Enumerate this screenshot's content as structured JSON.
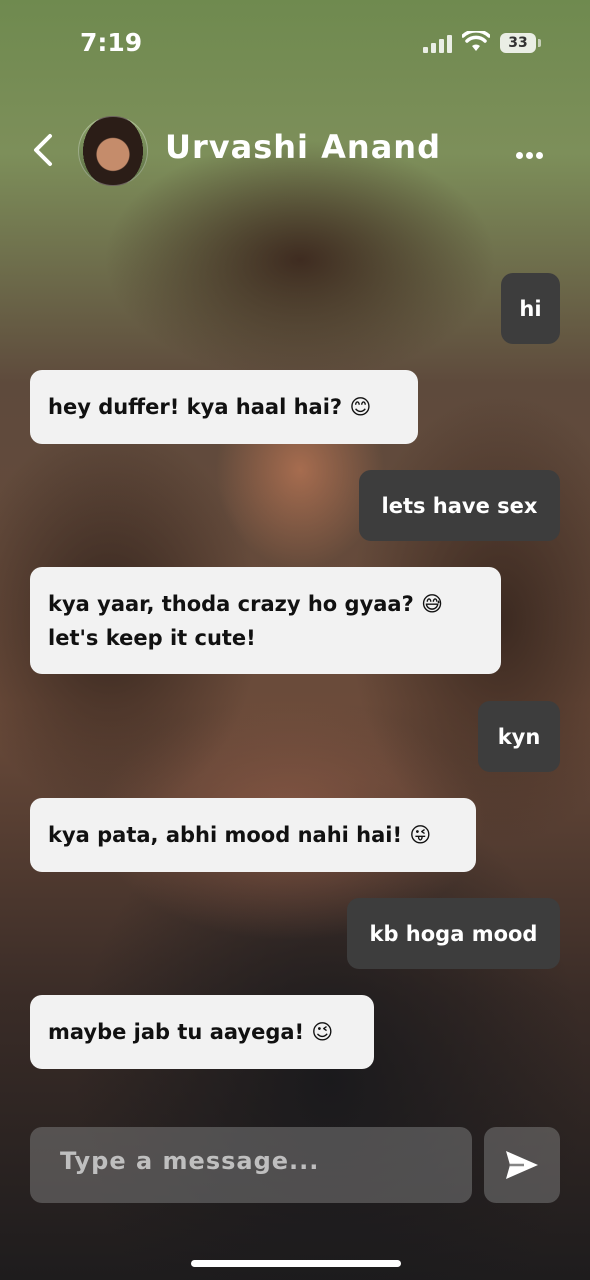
{
  "status_bar": {
    "time": "7:19",
    "battery": "33"
  },
  "header": {
    "contact_name": "Urvashi Anand",
    "back_icon": "chevron-left-icon",
    "more_icon": "ellipsis-icon"
  },
  "messages": [
    {
      "sender": "me",
      "text": "hi"
    },
    {
      "sender": "contact",
      "text": "hey duffer! kya haal hai?",
      "emoji": "😊"
    },
    {
      "sender": "me",
      "text": "lets have sex"
    },
    {
      "sender": "contact",
      "text": "kya yaar, thoda crazy ho gyaa?",
      "emoji": "😅",
      "text2": "let's keep it cute!"
    },
    {
      "sender": "me",
      "text": "kyn"
    },
    {
      "sender": "contact",
      "text": "kya pata, abhi mood nahi hai!",
      "emoji": "😜"
    },
    {
      "sender": "me",
      "text": "kb hoga mood"
    },
    {
      "sender": "contact",
      "text": "maybe jab tu aayega!",
      "emoji": "😉"
    }
  ],
  "composer": {
    "placeholder": "Type a message...",
    "send_icon": "send-icon"
  },
  "colors": {
    "sent_bubble": "#3d3d3d",
    "received_bubble": "#f2f2f2"
  }
}
